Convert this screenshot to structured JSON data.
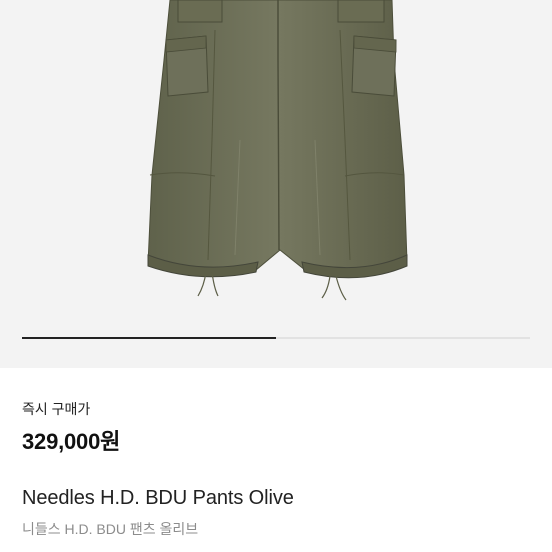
{
  "product": {
    "image_alt": "Needles H.D. BDU Pants Olive",
    "image_index_progress": 0.5,
    "price_label": "즉시 구매가",
    "price": "329,000원",
    "name": "Needles H.D. BDU Pants Olive",
    "name_ko": "니들스 H.D. BDU 팬츠 올리브"
  },
  "colors": {
    "pants_olive": "#6b6d55",
    "background": "#f3f3f3",
    "progress_active": "#222222",
    "progress_track": "#e2e2e2"
  }
}
